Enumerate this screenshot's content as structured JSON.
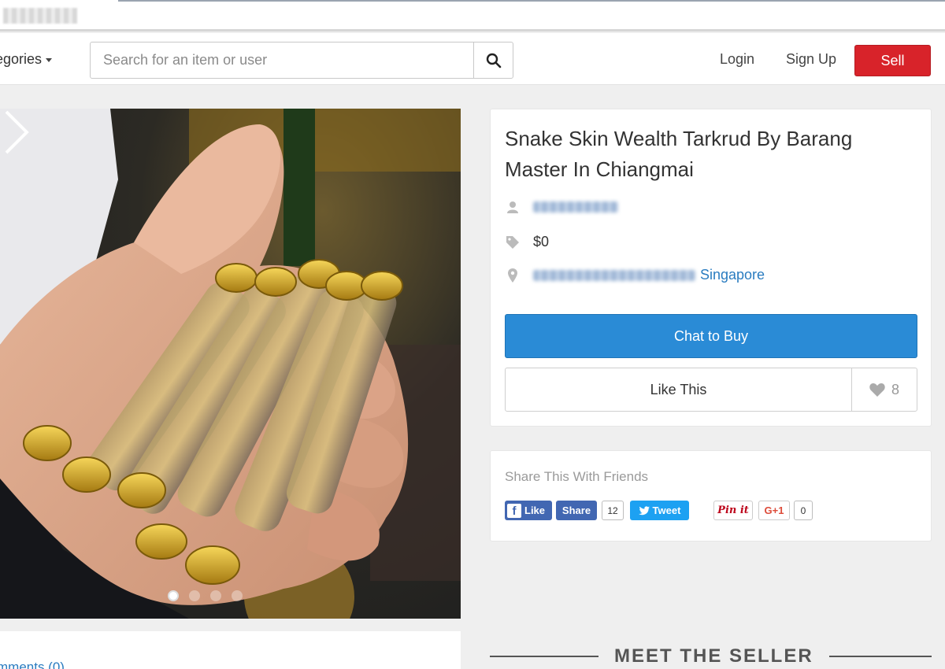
{
  "header": {
    "categories_label": "egories",
    "search_placeholder": "Search for an item or user",
    "login_label": "Login",
    "signup_label": "Sign Up",
    "sell_label": "Sell"
  },
  "gallery": {
    "slide_count": 4,
    "active_slide": 1,
    "next_icon": "chevron-right-icon"
  },
  "product": {
    "title": "Snake Skin Wealth Tarkrud By Barang Master In Chiangmai",
    "price": "$0",
    "location_country": "Singapore",
    "chat_label": "Chat to Buy",
    "like_label": "Like This",
    "like_count": "8"
  },
  "share": {
    "title": "Share This With Friends",
    "fb_like_label": "Like",
    "fb_share_label": "Share",
    "fb_share_count": "12",
    "tweet_label": "Tweet",
    "pinit_label": "Pin it",
    "gplus_label": "G+1",
    "gplus_count": "0"
  },
  "comments": {
    "label": "mments (0)"
  },
  "seller": {
    "heading": "MEET THE SELLER"
  },
  "colors": {
    "sell": "#d8232a",
    "chat": "#2a8bd6",
    "link": "#2a7cc0",
    "facebook": "#4267b2",
    "twitter": "#1da1f2"
  }
}
